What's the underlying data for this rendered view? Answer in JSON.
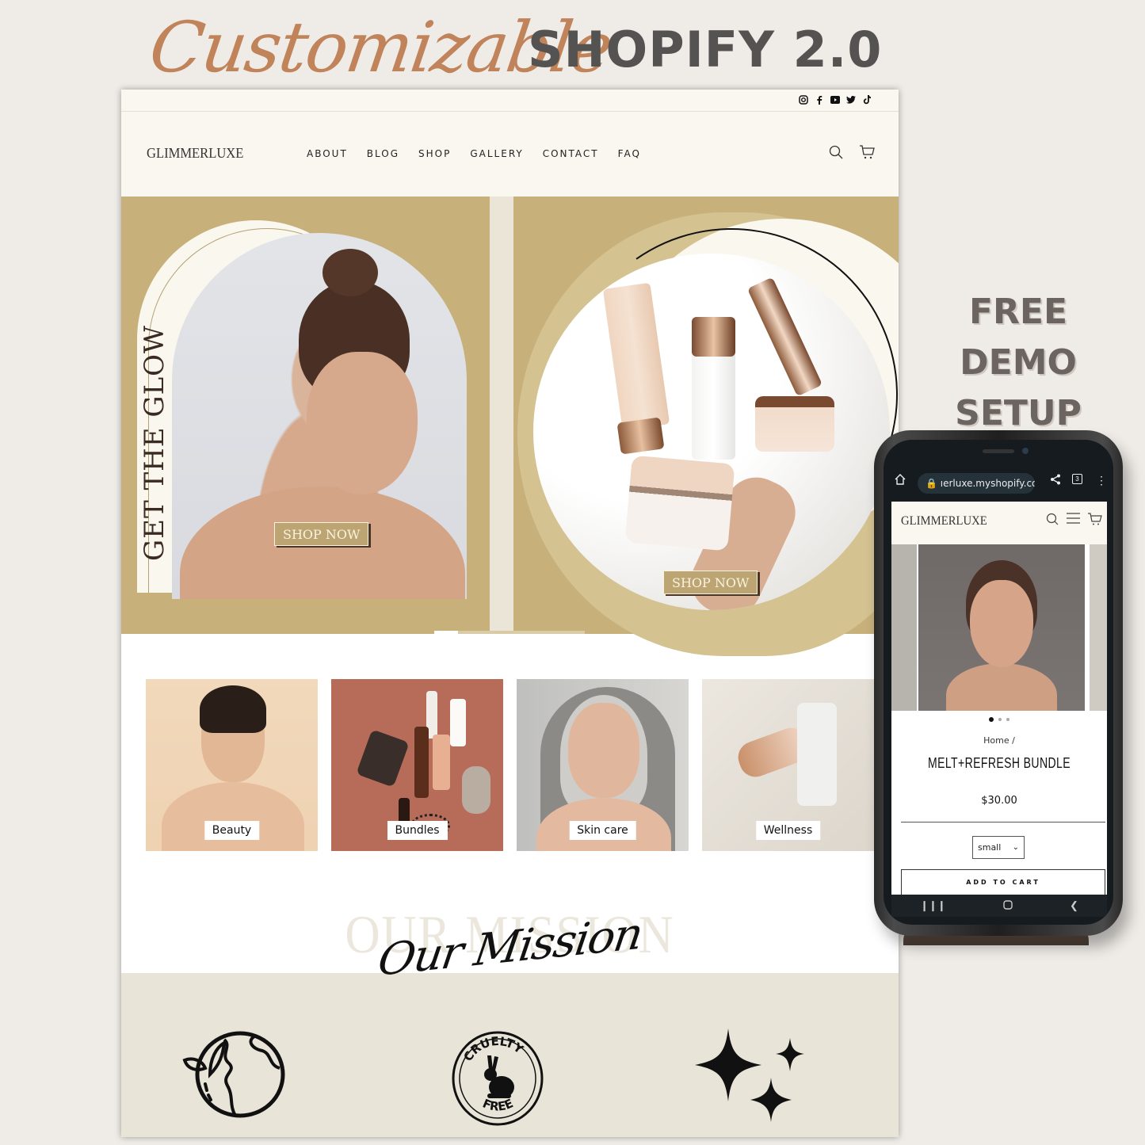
{
  "promo": {
    "script_heading": "Customizable",
    "title": "SHOPIFY 2.0",
    "side_line1": "FREE DEMO",
    "side_line2": "SETUP"
  },
  "colors": {
    "hero_gold": "#c7b07a",
    "cream": "#faf7f0",
    "mission_band": "#e9e4d8",
    "promo_script": "#c0835a",
    "promo_title": "#555352"
  },
  "desktop": {
    "social_icons": [
      "instagram-icon",
      "facebook-icon",
      "youtube-icon",
      "twitter-icon",
      "tiktok-icon"
    ],
    "logo": "GLIMMERLUXE",
    "nav": [
      "ABOUT",
      "BLOG",
      "SHOP",
      "GALLERY",
      "CONTACT",
      "FAQ"
    ],
    "header_icons": [
      "search-icon",
      "cart-icon"
    ],
    "hero": {
      "left_vertical_text": "GET THE GLOW",
      "left_button": "SHOP NOW",
      "right_button": "SHOP NOW",
      "slide_count": 2,
      "active_slide": 1
    },
    "collections": [
      {
        "label": "Beauty"
      },
      {
        "label": "Bundles"
      },
      {
        "label": "Skin care"
      },
      {
        "label": "Wellness"
      }
    ],
    "mission": {
      "background_text": "OUR MISSION",
      "script_text": "Our Mission",
      "badge_text_top": "CRUELTY",
      "badge_text_bottom": "FREE",
      "icons": [
        "eco-earth-leaf-icon",
        "cruelty-free-bunny-icon",
        "sparkles-icon"
      ]
    }
  },
  "phone": {
    "url": "ıerluxe.myshopify.com",
    "tab_count": "3",
    "logo": "GLIMMERLUXE",
    "gallery_dots": 3,
    "gallery_active": 1,
    "breadcrumb": "Home /",
    "product_title": "MELT+REFRESH BUNDLE",
    "price": "$30.00",
    "variant_selected": "small",
    "add_to_cart": "ADD TO CART"
  }
}
